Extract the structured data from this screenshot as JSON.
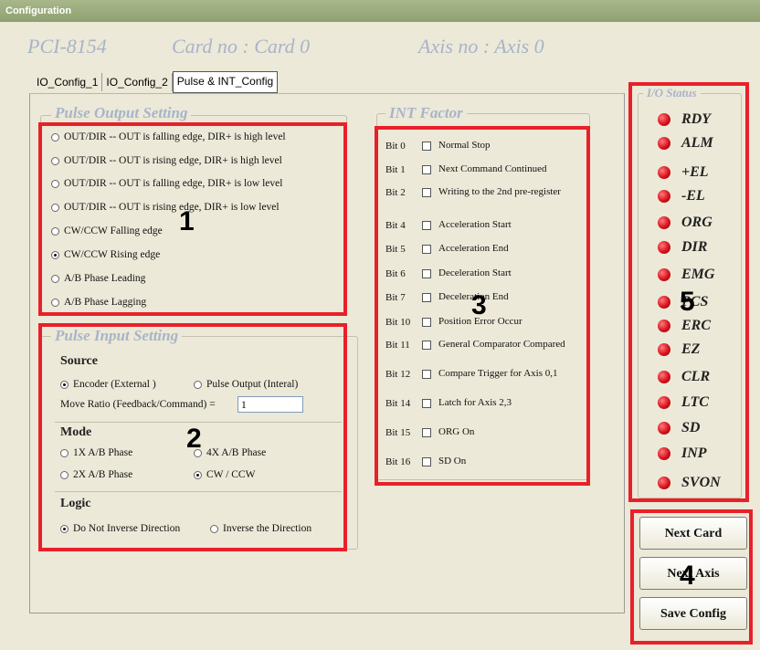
{
  "window": {
    "title": "Configuration"
  },
  "header": {
    "card_model": "PCI-8154",
    "card_no": "Card no : Card  0",
    "axis_no": "Axis no : Axis  0"
  },
  "tabs": [
    "IO_Config_1",
    "IO_Config_2",
    "Pulse & INT_Config"
  ],
  "pulse_output": {
    "title": "Pulse Output Setting",
    "options": [
      {
        "label": "OUT/DIR -- OUT is falling edge, DIR+ is high level",
        "checked": false
      },
      {
        "label": "OUT/DIR -- OUT is rising edge, DIR+ is high level",
        "checked": false
      },
      {
        "label": "OUT/DIR -- OUT is falling edge, DIR+ is low level",
        "checked": false
      },
      {
        "label": "OUT/DIR -- OUT is rising edge, DIR+ is low level",
        "checked": false
      },
      {
        "label": "CW/CCW Falling edge",
        "checked": false
      },
      {
        "label": "CW/CCW Rising edge",
        "checked": true
      },
      {
        "label": "A/B Phase Leading",
        "checked": false
      },
      {
        "label": "A/B Phase Lagging",
        "checked": false
      }
    ]
  },
  "pulse_input": {
    "title": "Pulse Input Setting",
    "source_label": "Source",
    "source_encoder": "Encoder (External )",
    "source_pulse": "Pulse Output (Interal)",
    "move_ratio_label": "Move Ratio (Feedback/Command) =",
    "move_ratio_value": "1",
    "mode_label": "Mode",
    "mode_1x": "1X A/B Phase",
    "mode_4x": "4X A/B Phase",
    "mode_2x": "2X A/B Phase",
    "mode_cw": "CW / CCW",
    "logic_label": "Logic",
    "logic_not": "Do Not Inverse Direction",
    "logic_inv": "Inverse the Direction"
  },
  "int_factor": {
    "title": "INT Factor",
    "rows": [
      {
        "bit": "Bit 0",
        "label": "Normal Stop"
      },
      {
        "bit": "Bit 1",
        "label": "Next Command Continued"
      },
      {
        "bit": "Bit 2",
        "label": "Writing to the 2nd pre-register"
      },
      {
        "bit": "Bit 4",
        "label": "Acceleration Start"
      },
      {
        "bit": "Bit 5",
        "label": "Acceleration End"
      },
      {
        "bit": "Bit 6",
        "label": "Deceleration Start"
      },
      {
        "bit": "Bit 7",
        "label": "Deceleration End"
      },
      {
        "bit": "Bit 10",
        "label": "Position Error Occur"
      },
      {
        "bit": "Bit 11",
        "label": "General Comparator Compared"
      },
      {
        "bit": "Bit 12",
        "label": "Compare Trigger for Axis 0,1"
      },
      {
        "bit": "Bit 14",
        "label": "Latch for Axis 2,3"
      },
      {
        "bit": "Bit 15",
        "label": "ORG On"
      },
      {
        "bit": "Bit 16",
        "label": "SD On"
      }
    ]
  },
  "io_status": {
    "title": "I/O Status",
    "items": [
      "RDY",
      "ALM",
      "+EL",
      "-EL",
      "ORG",
      "DIR",
      "EMG",
      "PCS",
      "ERC",
      "EZ",
      "CLR",
      "LTC",
      "SD",
      "INP",
      "SVON"
    ],
    "led_color": "#d8111e"
  },
  "buttons": {
    "next_card": "Next Card",
    "next_axis": "Next Axis",
    "save_config": "Save Config"
  },
  "annotations": [
    "1",
    "2",
    "3",
    "4",
    "5"
  ],
  "colors": {
    "annotation_box": "#e8202a",
    "group_title": "#a8b4c8",
    "background": "#ece9d8"
  }
}
